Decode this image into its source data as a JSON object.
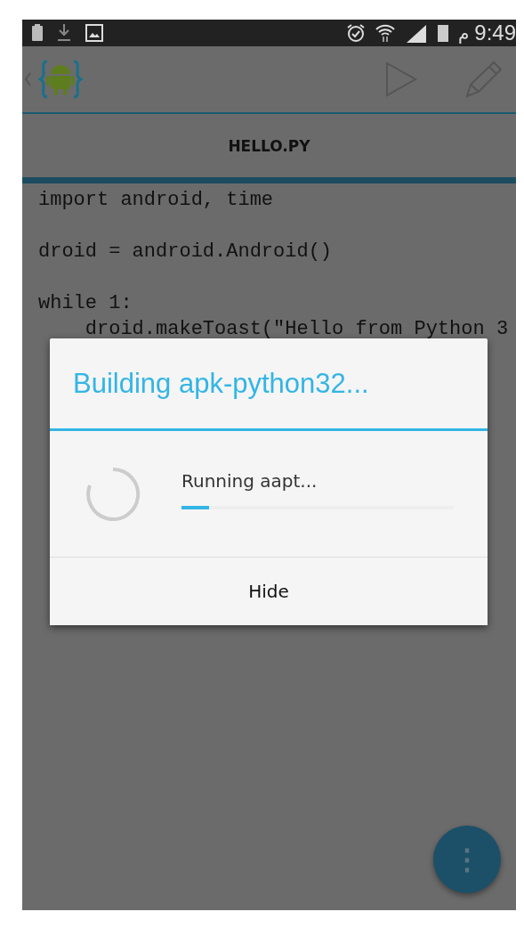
{
  "status_bar": {
    "time_suffix": "م",
    "time": "9:49"
  },
  "tabs": [
    {
      "label": "HELLO.PY",
      "selected": true
    }
  ],
  "editor": {
    "lines": [
      {
        "text": "import android, time",
        "blank_after": true
      },
      {
        "text": "droid = android.Android()",
        "blank_after": true
      },
      {
        "text": "while 1:",
        "blank_after": false
      },
      {
        "text": "    droid.makeToast(\"Hello from Python 3",
        "blank_after": false
      }
    ]
  },
  "dialog": {
    "title": "Building apk-python32...",
    "message": "Running aapt...",
    "progress": {
      "level": 0.1
    },
    "buttons": [
      "Hide"
    ]
  },
  "fab": {
    "glyph": "⋮"
  }
}
